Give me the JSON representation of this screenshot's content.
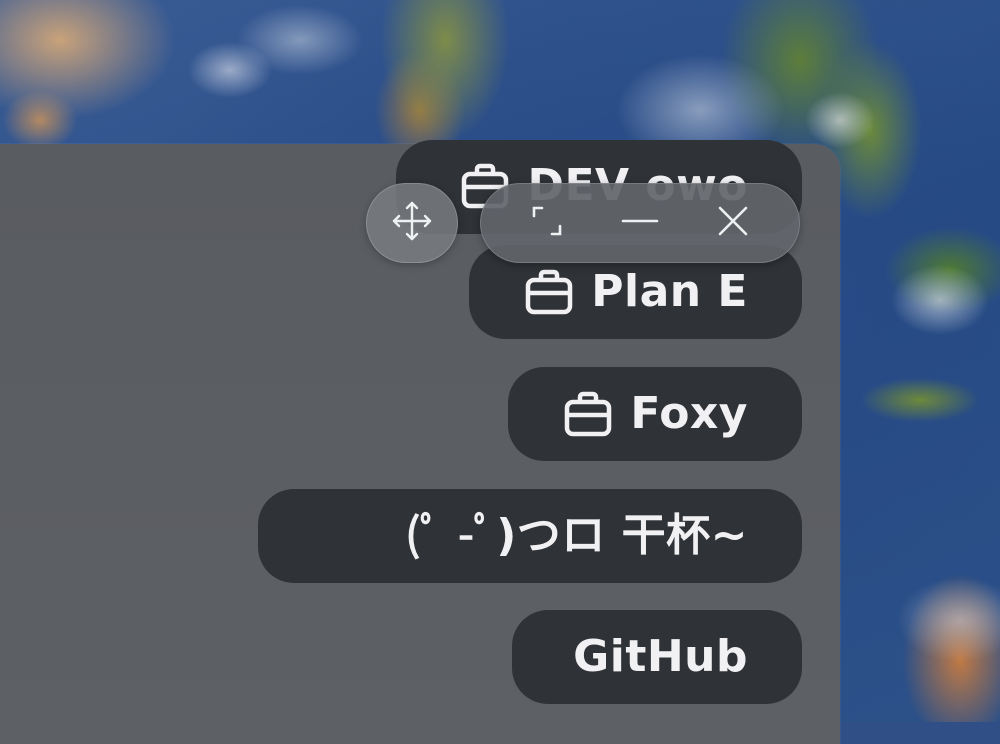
{
  "chips": {
    "dev": "DEV owo",
    "plan": "Plan E",
    "foxy": "Foxy",
    "cheers": "(ﾟ -ﾟ)つロ 干杯~",
    "github": "GitHub"
  },
  "icons": {
    "chip_icon": "briefcase-icon",
    "move": "move-icon",
    "maximize": "maximize-icon",
    "minimize": "minimize-icon",
    "close": "close-icon"
  }
}
